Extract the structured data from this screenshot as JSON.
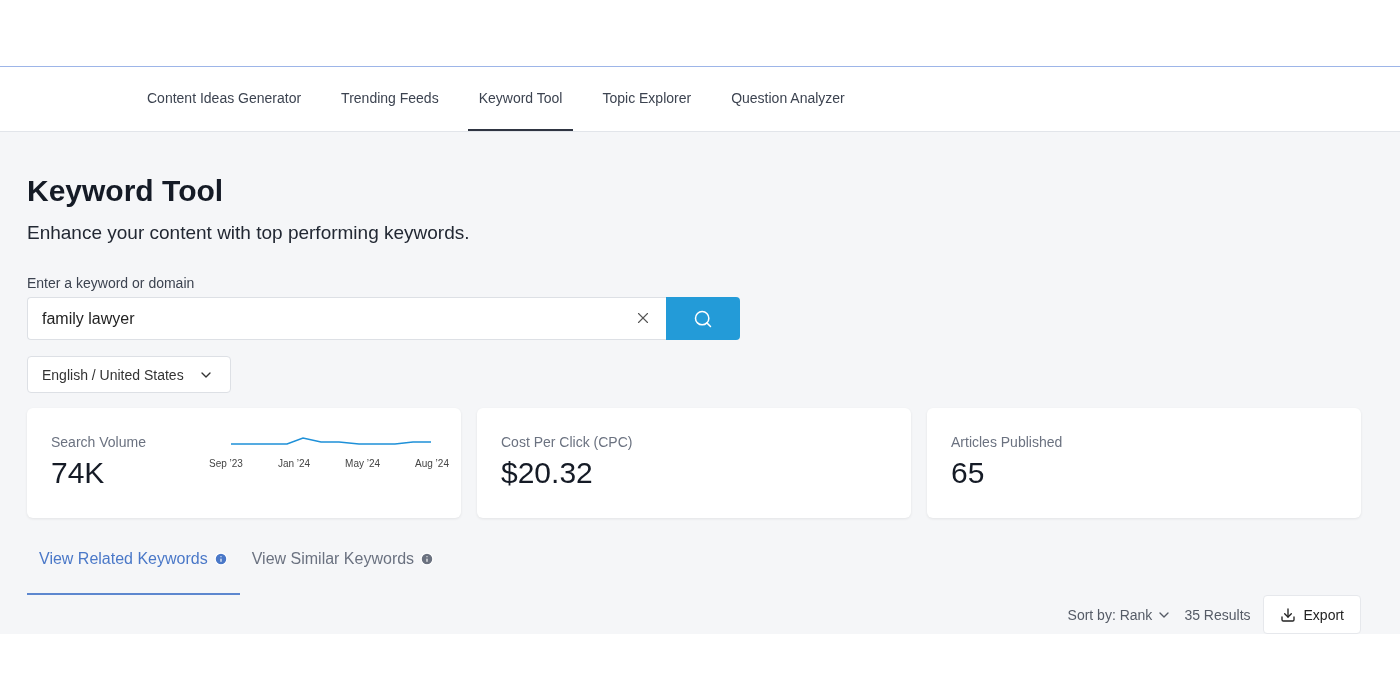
{
  "nav": {
    "tabs": [
      {
        "label": "Content Ideas Generator",
        "selected": false
      },
      {
        "label": "Trending Feeds",
        "selected": false
      },
      {
        "label": "Keyword Tool",
        "selected": true
      },
      {
        "label": "Topic Explorer",
        "selected": false
      },
      {
        "label": "Question Analyzer",
        "selected": false
      }
    ]
  },
  "page": {
    "title": "Keyword Tool",
    "subtitle": "Enhance your content with top performing keywords."
  },
  "search": {
    "label": "Enter a keyword or domain",
    "value": "family lawyer"
  },
  "locale": {
    "value": "English / United States"
  },
  "stats": [
    {
      "kind": "trend",
      "label": "Search Volume",
      "value": "74K",
      "axis_labels": [
        "Sep ’23",
        "Jan ’24",
        "May ’24",
        "Aug ’24"
      ]
    },
    {
      "kind": "plain",
      "label": "Cost Per Click (CPC)",
      "value": "$20.32"
    },
    {
      "kind": "plain",
      "label": "Articles Published",
      "value": "65"
    }
  ],
  "result_tabs": [
    {
      "label": "View Related Keywords",
      "selected": true
    },
    {
      "label": "View Similar Keywords",
      "selected": false
    }
  ],
  "toolbar": {
    "sort": "Sort by: Rank",
    "results": "35 Results",
    "export": "Export"
  }
}
